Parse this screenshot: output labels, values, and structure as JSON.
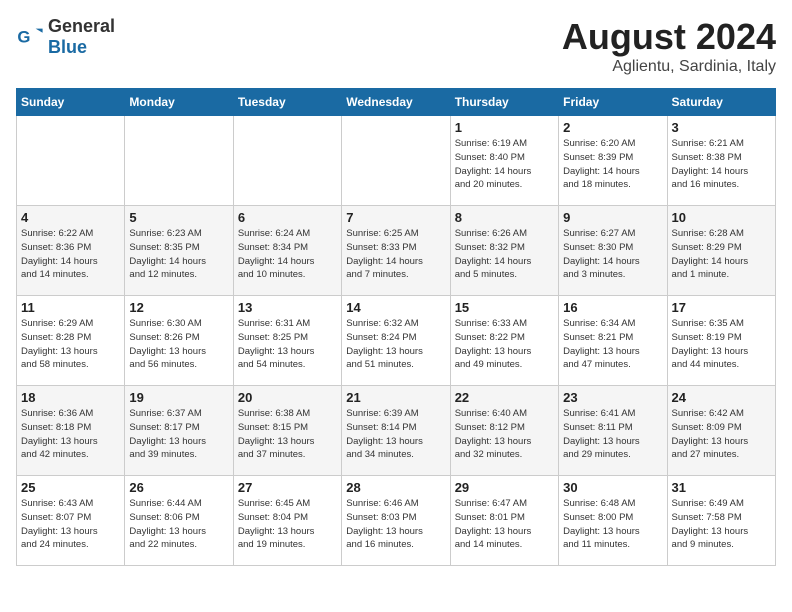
{
  "logo": {
    "general": "General",
    "blue": "Blue"
  },
  "title": "August 2024",
  "subtitle": "Aglientu, Sardinia, Italy",
  "days_of_week": [
    "Sunday",
    "Monday",
    "Tuesday",
    "Wednesday",
    "Thursday",
    "Friday",
    "Saturday"
  ],
  "weeks": [
    [
      {
        "day": "",
        "info": ""
      },
      {
        "day": "",
        "info": ""
      },
      {
        "day": "",
        "info": ""
      },
      {
        "day": "",
        "info": ""
      },
      {
        "day": "1",
        "info": "Sunrise: 6:19 AM\nSunset: 8:40 PM\nDaylight: 14 hours\nand 20 minutes."
      },
      {
        "day": "2",
        "info": "Sunrise: 6:20 AM\nSunset: 8:39 PM\nDaylight: 14 hours\nand 18 minutes."
      },
      {
        "day": "3",
        "info": "Sunrise: 6:21 AM\nSunset: 8:38 PM\nDaylight: 14 hours\nand 16 minutes."
      }
    ],
    [
      {
        "day": "4",
        "info": "Sunrise: 6:22 AM\nSunset: 8:36 PM\nDaylight: 14 hours\nand 14 minutes."
      },
      {
        "day": "5",
        "info": "Sunrise: 6:23 AM\nSunset: 8:35 PM\nDaylight: 14 hours\nand 12 minutes."
      },
      {
        "day": "6",
        "info": "Sunrise: 6:24 AM\nSunset: 8:34 PM\nDaylight: 14 hours\nand 10 minutes."
      },
      {
        "day": "7",
        "info": "Sunrise: 6:25 AM\nSunset: 8:33 PM\nDaylight: 14 hours\nand 7 minutes."
      },
      {
        "day": "8",
        "info": "Sunrise: 6:26 AM\nSunset: 8:32 PM\nDaylight: 14 hours\nand 5 minutes."
      },
      {
        "day": "9",
        "info": "Sunrise: 6:27 AM\nSunset: 8:30 PM\nDaylight: 14 hours\nand 3 minutes."
      },
      {
        "day": "10",
        "info": "Sunrise: 6:28 AM\nSunset: 8:29 PM\nDaylight: 14 hours\nand 1 minute."
      }
    ],
    [
      {
        "day": "11",
        "info": "Sunrise: 6:29 AM\nSunset: 8:28 PM\nDaylight: 13 hours\nand 58 minutes."
      },
      {
        "day": "12",
        "info": "Sunrise: 6:30 AM\nSunset: 8:26 PM\nDaylight: 13 hours\nand 56 minutes."
      },
      {
        "day": "13",
        "info": "Sunrise: 6:31 AM\nSunset: 8:25 PM\nDaylight: 13 hours\nand 54 minutes."
      },
      {
        "day": "14",
        "info": "Sunrise: 6:32 AM\nSunset: 8:24 PM\nDaylight: 13 hours\nand 51 minutes."
      },
      {
        "day": "15",
        "info": "Sunrise: 6:33 AM\nSunset: 8:22 PM\nDaylight: 13 hours\nand 49 minutes."
      },
      {
        "day": "16",
        "info": "Sunrise: 6:34 AM\nSunset: 8:21 PM\nDaylight: 13 hours\nand 47 minutes."
      },
      {
        "day": "17",
        "info": "Sunrise: 6:35 AM\nSunset: 8:19 PM\nDaylight: 13 hours\nand 44 minutes."
      }
    ],
    [
      {
        "day": "18",
        "info": "Sunrise: 6:36 AM\nSunset: 8:18 PM\nDaylight: 13 hours\nand 42 minutes."
      },
      {
        "day": "19",
        "info": "Sunrise: 6:37 AM\nSunset: 8:17 PM\nDaylight: 13 hours\nand 39 minutes."
      },
      {
        "day": "20",
        "info": "Sunrise: 6:38 AM\nSunset: 8:15 PM\nDaylight: 13 hours\nand 37 minutes."
      },
      {
        "day": "21",
        "info": "Sunrise: 6:39 AM\nSunset: 8:14 PM\nDaylight: 13 hours\nand 34 minutes."
      },
      {
        "day": "22",
        "info": "Sunrise: 6:40 AM\nSunset: 8:12 PM\nDaylight: 13 hours\nand 32 minutes."
      },
      {
        "day": "23",
        "info": "Sunrise: 6:41 AM\nSunset: 8:11 PM\nDaylight: 13 hours\nand 29 minutes."
      },
      {
        "day": "24",
        "info": "Sunrise: 6:42 AM\nSunset: 8:09 PM\nDaylight: 13 hours\nand 27 minutes."
      }
    ],
    [
      {
        "day": "25",
        "info": "Sunrise: 6:43 AM\nSunset: 8:07 PM\nDaylight: 13 hours\nand 24 minutes."
      },
      {
        "day": "26",
        "info": "Sunrise: 6:44 AM\nSunset: 8:06 PM\nDaylight: 13 hours\nand 22 minutes."
      },
      {
        "day": "27",
        "info": "Sunrise: 6:45 AM\nSunset: 8:04 PM\nDaylight: 13 hours\nand 19 minutes."
      },
      {
        "day": "28",
        "info": "Sunrise: 6:46 AM\nSunset: 8:03 PM\nDaylight: 13 hours\nand 16 minutes."
      },
      {
        "day": "29",
        "info": "Sunrise: 6:47 AM\nSunset: 8:01 PM\nDaylight: 13 hours\nand 14 minutes."
      },
      {
        "day": "30",
        "info": "Sunrise: 6:48 AM\nSunset: 8:00 PM\nDaylight: 13 hours\nand 11 minutes."
      },
      {
        "day": "31",
        "info": "Sunrise: 6:49 AM\nSunset: 7:58 PM\nDaylight: 13 hours\nand 9 minutes."
      }
    ]
  ]
}
